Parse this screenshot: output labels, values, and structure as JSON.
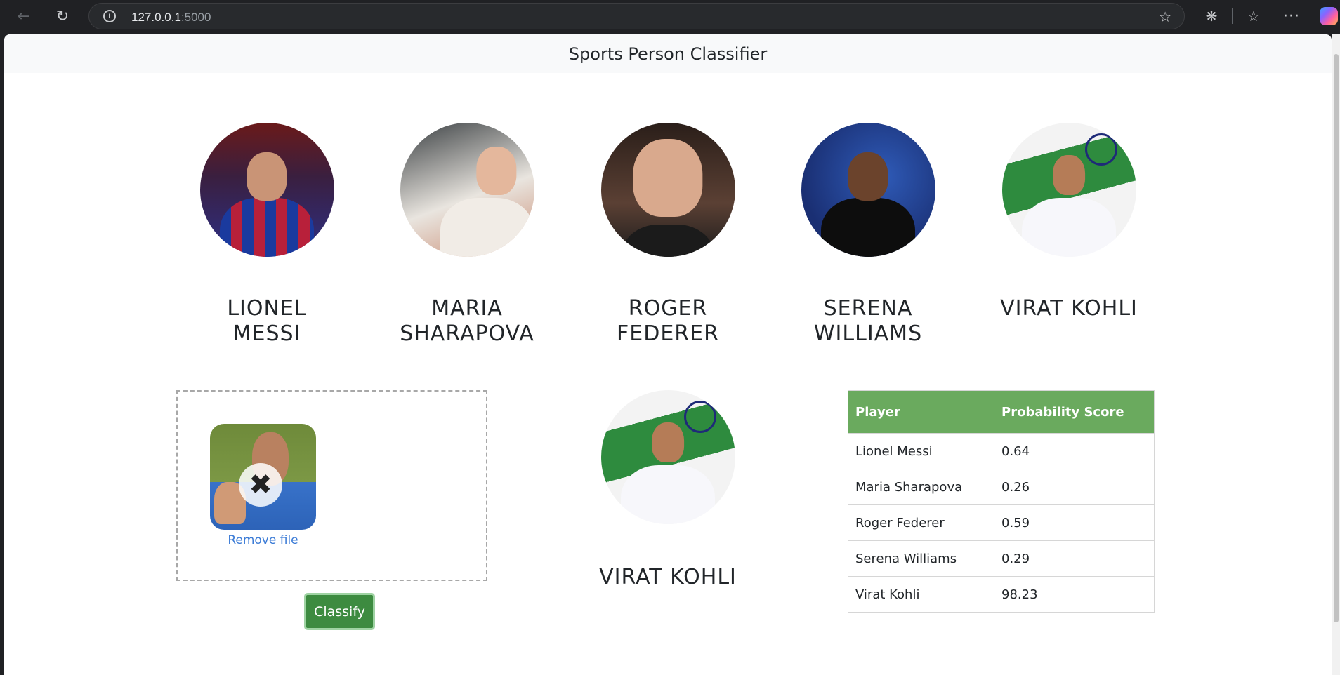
{
  "browser": {
    "url_host": "127.0.0.1",
    "url_port": ":5000"
  },
  "page": {
    "title": "Sports Person Classifier"
  },
  "players": [
    {
      "name_line1": "LIONEL",
      "name_line2": "MESSI"
    },
    {
      "name_line1": "MARIA",
      "name_line2": "SHARAPOVA"
    },
    {
      "name_line1": "ROGER",
      "name_line2": "FEDERER"
    },
    {
      "name_line1": "SERENA",
      "name_line2": "WILLIAMS"
    },
    {
      "name_line1": "VIRAT KOHLI",
      "name_line2": ""
    }
  ],
  "upload": {
    "remove_label": "Remove file",
    "remove_icon": "close-icon"
  },
  "classify_label": "Classify",
  "result": {
    "name": "VIRAT KOHLI"
  },
  "table": {
    "headers": [
      "Player",
      "Probability Score"
    ],
    "rows": [
      {
        "player": "Lionel Messi",
        "score": "0.64"
      },
      {
        "player": "Maria Sharapova",
        "score": "0.26"
      },
      {
        "player": "Roger Federer",
        "score": "0.59"
      },
      {
        "player": "Serena Williams",
        "score": "0.29"
      },
      {
        "player": "Virat Kohli",
        "score": "98.23"
      }
    ]
  },
  "colors": {
    "table_header": "#6aaa5e",
    "classify_button": "#3d8b40",
    "link": "#3b7bd6"
  }
}
